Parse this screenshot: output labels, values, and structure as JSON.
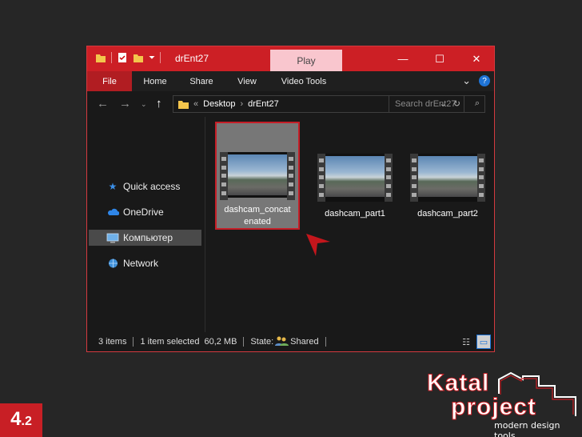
{
  "window": {
    "title": "drEnt27",
    "contextual_tab": "Play",
    "controls": {
      "minimize": "—",
      "maximize": "☐",
      "close": "✕"
    }
  },
  "ribbon": {
    "tabs": [
      "File",
      "Home",
      "Share",
      "View",
      "Video Tools"
    ],
    "collapse_glyph": "⌄",
    "help_glyph": "?"
  },
  "nav": {
    "back": "←",
    "forward": "→",
    "recent": "⌄",
    "up": "↑"
  },
  "address": {
    "overflow": "«",
    "segments": [
      "Desktop",
      "drEnt27"
    ],
    "separator": "›",
    "dropdown_glyph": "⌄",
    "refresh_glyph": "↻"
  },
  "search": {
    "placeholder": "Search drEnt27",
    "glyph": "⌕"
  },
  "sidebar": {
    "items": [
      {
        "label": "Quick access",
        "icon": "star-icon"
      },
      {
        "label": "OneDrive",
        "icon": "cloud-icon"
      },
      {
        "label": "Компьютер",
        "icon": "computer-icon",
        "selected": true
      },
      {
        "label": "Network",
        "icon": "network-icon"
      }
    ]
  },
  "files": [
    {
      "label": "dashcam_concat enated",
      "selected": true
    },
    {
      "label": "dashcam_part1",
      "selected": false
    },
    {
      "label": "dashcam_part2",
      "selected": false
    }
  ],
  "status": {
    "items_count": "3 items",
    "selection": "1 item selected",
    "size": "60,2 MB",
    "state_label": "State:",
    "state_value": "Shared"
  },
  "step": {
    "major": "4",
    "minor": ".2"
  },
  "logo": {
    "line1": "Katal",
    "line2": "project",
    "tagline": "modern design tools"
  },
  "colors": {
    "accent_red": "#cc1f25",
    "contextual_pink": "#f9c6ce",
    "background": "#262626"
  }
}
